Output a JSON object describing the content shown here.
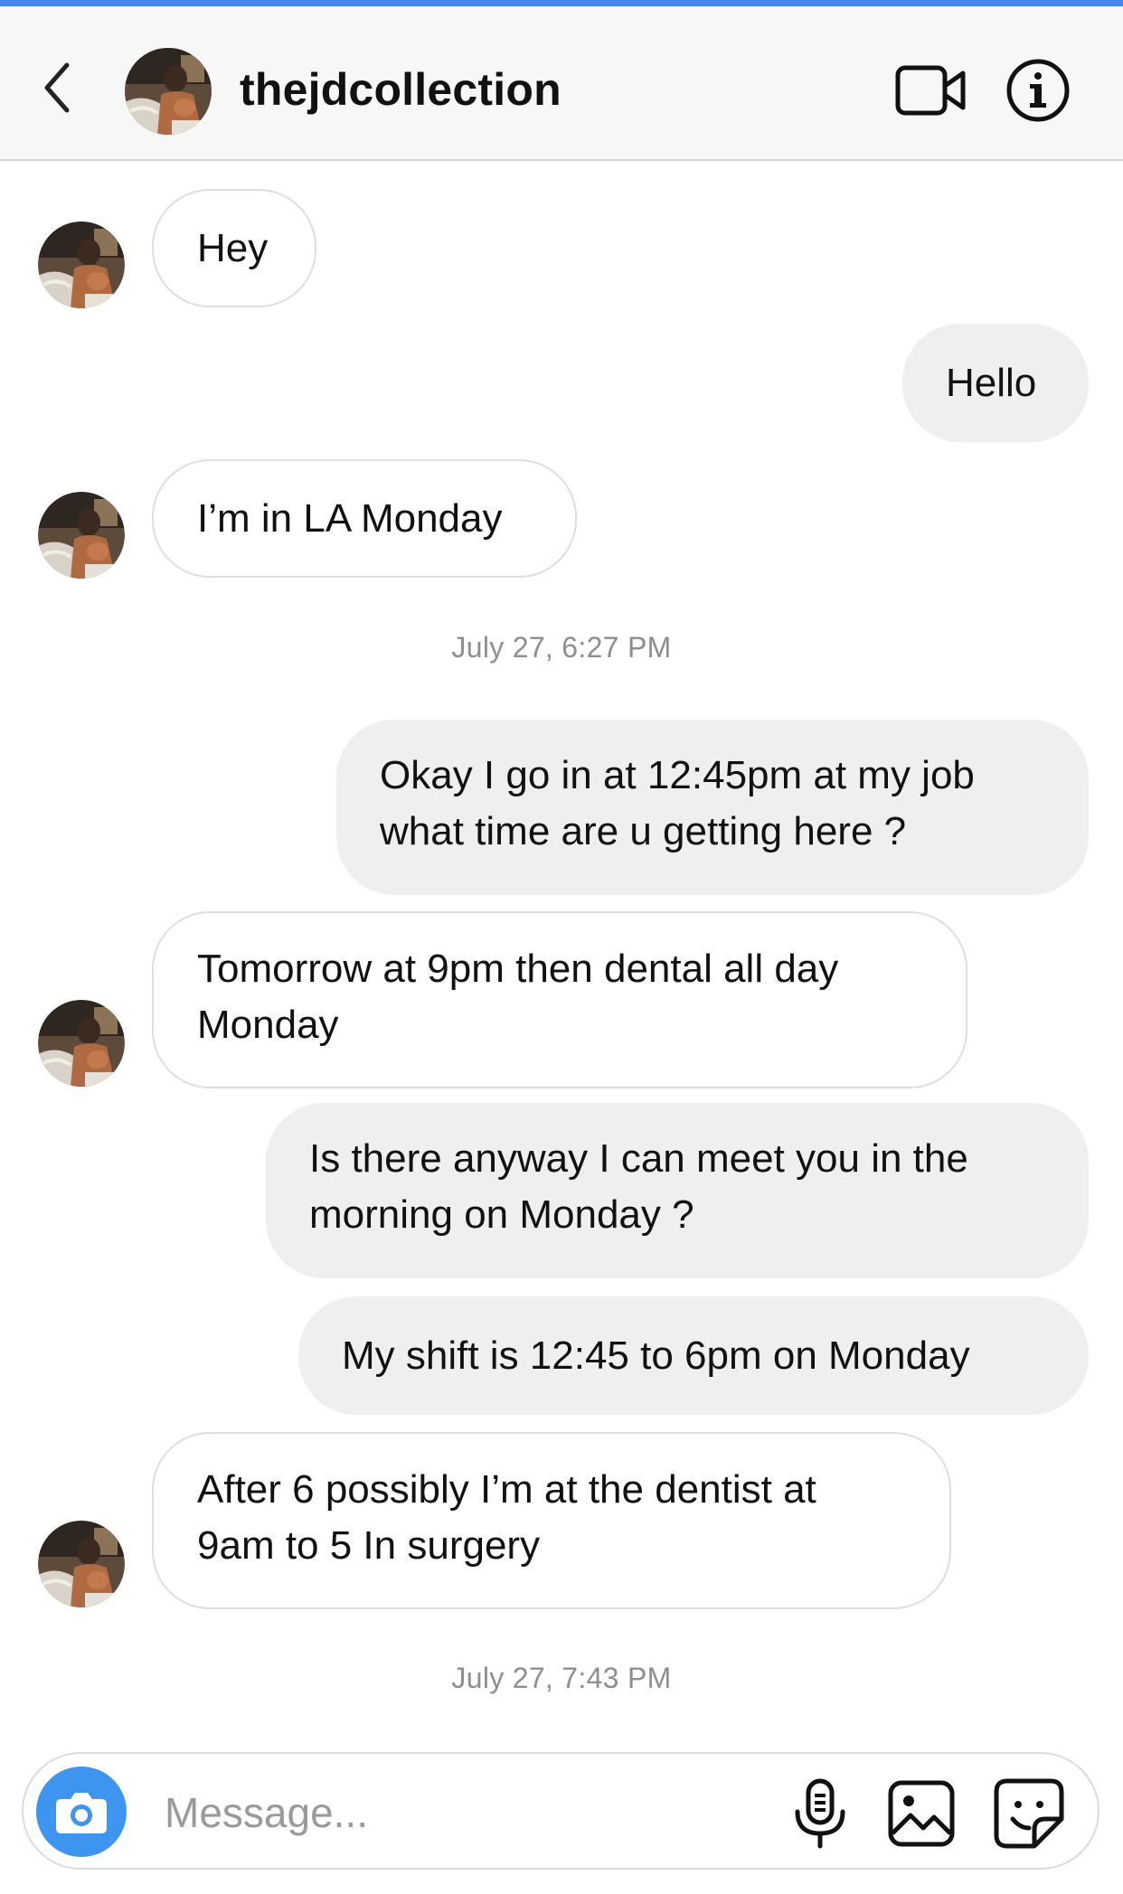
{
  "header": {
    "username": "thejdcollection"
  },
  "messages": [
    {
      "side": "in",
      "text": "Hey"
    },
    {
      "side": "out",
      "text": "Hello"
    },
    {
      "side": "in",
      "text": "I’m in LA Monday"
    },
    {
      "timestamp": "July 27, 6:27 PM"
    },
    {
      "side": "out",
      "lines": [
        "Okay I go in at 12:45pm at my job",
        "what time are u getting here ?"
      ]
    },
    {
      "side": "in",
      "lines": [
        "Tomorrow at 9pm then dental all day",
        "Monday"
      ]
    },
    {
      "side": "out",
      "lines": [
        "Is there anyway I can meet you in the",
        "morning on Monday ?"
      ]
    },
    {
      "side": "out",
      "text": "My shift is 12:45 to 6pm on Monday"
    },
    {
      "side": "in",
      "lines": [
        "After 6 possibly I’m at the dentist at",
        "9am to 5 In surgery"
      ]
    },
    {
      "timestamp": "July 27, 7:43 PM"
    }
  ],
  "composer": {
    "placeholder": "Message..."
  },
  "icons": {
    "back": "chevron-left-icon",
    "video": "video-camera-icon",
    "info": "info-icon",
    "camera": "camera-icon",
    "mic": "microphone-icon",
    "gallery": "image-icon",
    "sticker": "sticker-icon"
  },
  "colors": {
    "accent": "#3d95ef",
    "top_bar": "#4a86e8",
    "outgoing_bubble": "#efefef",
    "timestamp": "#8e8e8e"
  }
}
